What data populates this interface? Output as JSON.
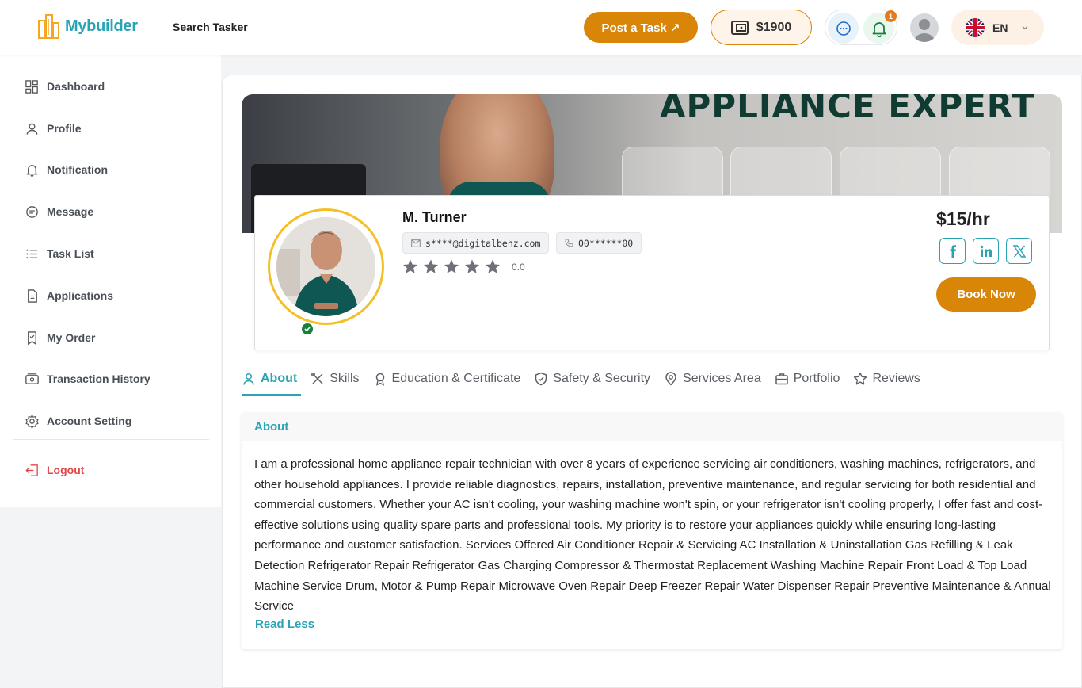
{
  "header": {
    "logo_text": "Mybuilder",
    "search_tasker": "Search Tasker",
    "post_task": "Post a Task ↗",
    "wallet_amount": "$1900",
    "notification_count": "1",
    "language": "EN"
  },
  "sidebar": {
    "items": [
      {
        "label": "Dashboard",
        "icon": "dashboard-icon"
      },
      {
        "label": "Profile",
        "icon": "user-icon"
      },
      {
        "label": "Notification",
        "icon": "bell-icon"
      },
      {
        "label": "Message",
        "icon": "chat-icon"
      },
      {
        "label": "Task List",
        "icon": "list-icon"
      },
      {
        "label": "Applications",
        "icon": "document-icon"
      },
      {
        "label": "My Order",
        "icon": "bookmark-icon"
      },
      {
        "label": "Transaction History",
        "icon": "wallet-icon"
      },
      {
        "label": "Account Setting",
        "icon": "gear-icon"
      }
    ],
    "logout": "Logout"
  },
  "banner": {
    "title": "APPLIANCE EXPERT"
  },
  "profile": {
    "name": "M. Turner",
    "email": "s****@digitalbenz.com",
    "phone": "00******00",
    "rating": "0.0",
    "rate": "$15/hr",
    "book_now": "Book Now"
  },
  "tabs": [
    {
      "label": "About",
      "active": true
    },
    {
      "label": "Skills"
    },
    {
      "label": "Education & Certificate"
    },
    {
      "label": "Safety & Security"
    },
    {
      "label": "Services Area"
    },
    {
      "label": "Portfolio"
    },
    {
      "label": "Reviews"
    }
  ],
  "about": {
    "heading": "About",
    "text": "I am a professional home appliance repair technician with over 8 years of experience servicing air conditioners, washing machines, refrigerators, and other household appliances. I provide reliable diagnostics, repairs, installation, preventive maintenance, and regular servicing for both residential and commercial customers. Whether your AC isn't cooling, your washing machine won't spin, or your refrigerator isn't cooling properly, I offer fast and cost-effective solutions using quality spare parts and professional tools. My priority is to restore your appliances quickly while ensuring long-lasting performance and customer satisfaction. Services Offered Air Conditioner Repair & Servicing AC Installation & Uninstallation Gas Refilling & Leak Detection Refrigerator Repair Refrigerator Gas Charging Compressor & Thermostat Replacement Washing Machine Repair Front Load & Top Load Machine Service Drum, Motor & Pump Repair Microwave Oven Repair Deep Freezer Repair Water Dispenser Repair Preventive Maintenance & Annual Service",
    "read_less": "Read Less"
  },
  "colors": {
    "accent": "#2aa3b5",
    "primary_orange": "#d88508",
    "logout_red": "#e04848"
  }
}
